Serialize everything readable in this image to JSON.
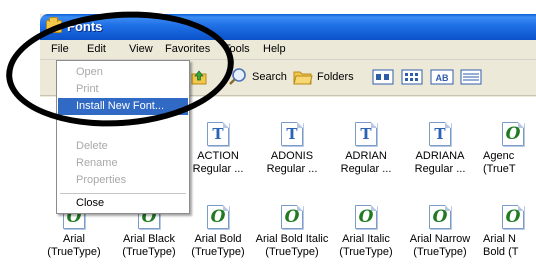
{
  "window": {
    "title": "Fonts"
  },
  "menubar": {
    "items": [
      "File",
      "Edit",
      "View",
      "Favorites",
      "Tools",
      "Help"
    ]
  },
  "toolbar": {
    "search_label": "Search",
    "folders_label": "Folders"
  },
  "file_menu": {
    "items": [
      {
        "label": "Open",
        "state": "disabled"
      },
      {
        "label": "Print",
        "state": "disabled"
      },
      {
        "label": "Install New Font...",
        "state": "highlighted"
      },
      {
        "label": "Delete",
        "state": "disabled"
      },
      {
        "label": "Rename",
        "state": "disabled"
      },
      {
        "label": "Properties",
        "state": "disabled"
      },
      {
        "label": "Close",
        "state": "enabled"
      }
    ]
  },
  "fonts_row1": [
    {
      "line1": "ACTION",
      "line2": "Regular ...",
      "icon": "truetype-font-icon"
    },
    {
      "line1": "ADONIS",
      "line2": "Regular ...",
      "icon": "truetype-font-icon"
    },
    {
      "line1": "ADRIAN",
      "line2": "Regular ...",
      "icon": "truetype-font-icon"
    },
    {
      "line1": "ADRIANA",
      "line2": "Regular ...",
      "icon": "truetype-font-icon"
    },
    {
      "line1": "Agenc",
      "line2": "(TrueT",
      "icon": "opentype-font-icon"
    }
  ],
  "fonts_row2": [
    {
      "line1": "Arial",
      "line2": "(TrueType)"
    },
    {
      "line1": "Arial Black",
      "line2": "(TrueType)"
    },
    {
      "line1": "Arial Bold",
      "line2": "(TrueType)"
    },
    {
      "line1": "Arial Bold Italic",
      "line2": "(TrueType)"
    },
    {
      "line1": "Arial Italic",
      "line2": "(TrueType)"
    },
    {
      "line1": "Arial Narrow",
      "line2": "(TrueType)"
    },
    {
      "line1": "Arial N",
      "line2": "Bold (T"
    }
  ],
  "glyphs": {
    "truetype": "T",
    "opentype": "O"
  },
  "colors": {
    "titlebar": "#0a52c9",
    "menu_highlight": "#316ac5",
    "truetype_icon": "#2a63b8",
    "opentype_icon": "#1f7a22"
  }
}
